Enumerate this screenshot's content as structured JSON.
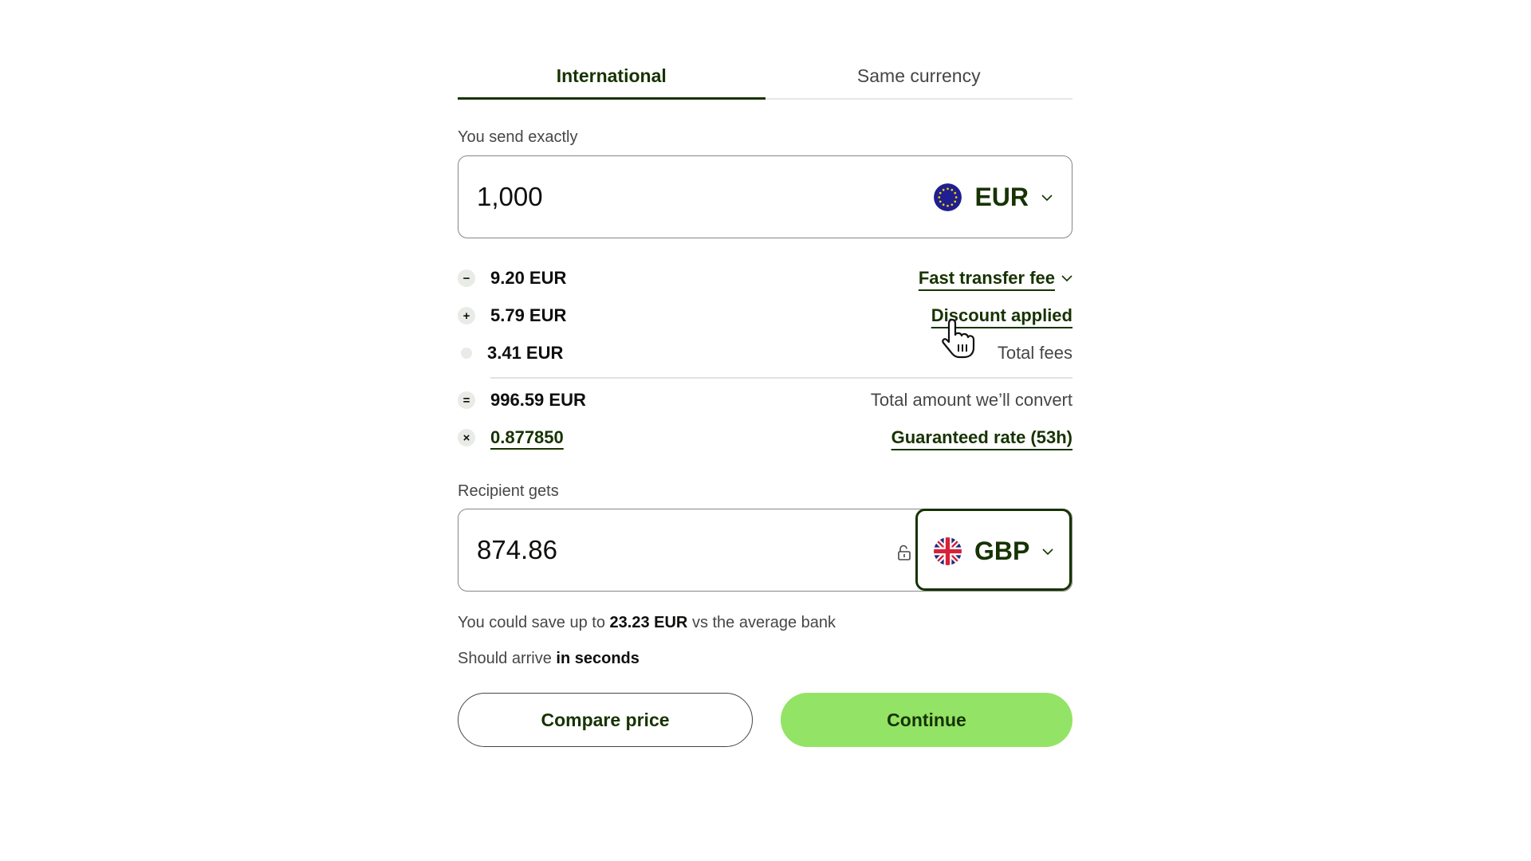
{
  "tabs": [
    {
      "label": "International",
      "active": true
    },
    {
      "label": "Same currency",
      "active": false
    }
  ],
  "send": {
    "label": "You send exactly",
    "amount": "1,000",
    "currency": "EUR",
    "flag_icon": "eu-flag-icon"
  },
  "fees": [
    {
      "symbol": "−",
      "icon": "minus-icon",
      "amount": "9.20 EUR",
      "right_label": "Fast transfer fee",
      "right_style": "link-dropdown"
    },
    {
      "symbol": "+",
      "icon": "plus-icon",
      "amount": "5.79 EUR",
      "right_label": "Discount applied",
      "right_style": "link"
    },
    {
      "symbol": "",
      "icon": "dot-icon",
      "amount": "3.41 EUR",
      "right_label": "Total fees",
      "right_style": "text"
    },
    {
      "symbol": "=",
      "icon": "equals-icon",
      "amount": "996.59 EUR",
      "right_label": "Total amount we’ll convert",
      "right_style": "text"
    },
    {
      "symbol": "×",
      "icon": "times-icon",
      "amount": "0.877850",
      "right_label": "Guaranteed rate (53h)",
      "right_style": "link"
    }
  ],
  "receive": {
    "label": "Recipient gets",
    "amount": "874.86",
    "currency": "GBP",
    "flag_icon": "uk-flag-icon"
  },
  "savings": {
    "prefix": "You could save up to",
    "amount": "23.23 EUR",
    "suffix": "vs the average bank"
  },
  "arrival": {
    "prefix": "Should arrive",
    "value": "in seconds"
  },
  "buttons": {
    "compare": "Compare price",
    "continue": "Continue"
  },
  "colors": {
    "brand_dark": "#163300",
    "primary_button": "#93e366",
    "eu_blue": "#1f1f8f",
    "text_secondary": "#454745"
  }
}
